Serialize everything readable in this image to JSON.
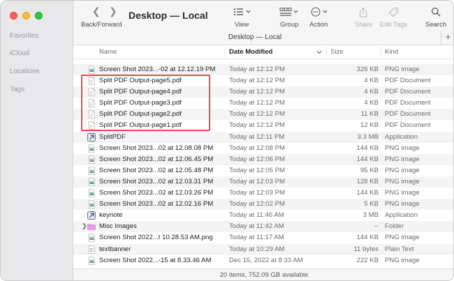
{
  "window": {
    "title": "Desktop — Local",
    "path_title": "Desktop — Local"
  },
  "sidebar": {
    "items": [
      {
        "label": "Favorites"
      },
      {
        "label": "iCloud"
      },
      {
        "label": "Locations"
      },
      {
        "label": "Tags"
      }
    ]
  },
  "toolbar": {
    "back_forward_label": "Back/Forward",
    "view_label": "View",
    "group_label": "Group",
    "action_label": "Action",
    "share_label": "Share",
    "edit_tags_label": "Edit Tags",
    "search_label": "Search"
  },
  "columns": {
    "name": "Name",
    "date": "Date Modified",
    "size": "Size",
    "kind": "Kind"
  },
  "files": [
    {
      "name": "Screen Shot 2023...-02 at 12.12.19 PM",
      "date": "Today at 12:12 PM",
      "size": "326 KB",
      "kind": "PNG image",
      "icon": "image-file-icon"
    },
    {
      "name": "Split PDF Output-page5.pdf",
      "date": "Today at 12:12 PM",
      "size": "4 KB",
      "kind": "PDF Document",
      "icon": "pdf-file-icon"
    },
    {
      "name": "Split PDF Output-page4.pdf",
      "date": "Today at 12:12 PM",
      "size": "4 KB",
      "kind": "PDF Document",
      "icon": "pdf-file-icon"
    },
    {
      "name": "Split PDF Output-page3.pdf",
      "date": "Today at 12:12 PM",
      "size": "4 KB",
      "kind": "PDF Document",
      "icon": "pdf-file-icon"
    },
    {
      "name": "Split PDF Output-page2.pdf",
      "date": "Today at 12:12 PM",
      "size": "11 KB",
      "kind": "PDF Document",
      "icon": "pdf-file-icon"
    },
    {
      "name": "Split PDF Output-page1.pdf",
      "date": "Today at 12:12 PM",
      "size": "12 KB",
      "kind": "PDF Document",
      "icon": "pdf-file-icon"
    },
    {
      "name": "SplitPDF",
      "date": "Today at 12:11 PM",
      "size": "3.3 MB",
      "kind": "Application",
      "icon": "app-icon"
    },
    {
      "name": "Screen Shot 2023...02 at 12.08.08 PM",
      "date": "Today at 12:08 PM",
      "size": "144 KB",
      "kind": "PNG image",
      "icon": "image-file-icon"
    },
    {
      "name": "Screen Shot 2023...02 at 12.06.45 PM",
      "date": "Today at 12:06 PM",
      "size": "144 KB",
      "kind": "PNG image",
      "icon": "image-file-icon"
    },
    {
      "name": "Screen Shot 2023...02 at 12.05.48 PM",
      "date": "Today at 12:05 PM",
      "size": "95 KB",
      "kind": "PNG image",
      "icon": "image-file-icon"
    },
    {
      "name": "Screen Shot 2023...02 at 12.03.31 PM",
      "date": "Today at 12:03 PM",
      "size": "128 KB",
      "kind": "PNG image",
      "icon": "image-file-icon"
    },
    {
      "name": "Screen Shot 2023...02 at 12.03.26 PM",
      "date": "Today at 12:03 PM",
      "size": "144 KB",
      "kind": "PNG image",
      "icon": "image-file-icon"
    },
    {
      "name": "Screen Shot 2023...02 at 12.02.16 PM",
      "date": "Today at 12:02 PM",
      "size": "5 KB",
      "kind": "PNG image",
      "icon": "image-file-icon"
    },
    {
      "name": "keynote",
      "date": "Today at 11:46 AM",
      "size": "3 MB",
      "kind": "Application",
      "icon": "app-icon"
    },
    {
      "name": "Misc Images",
      "date": "Today at 11:42 AM",
      "size": "--",
      "kind": "Folder",
      "icon": "folder-icon",
      "disclosure": "true"
    },
    {
      "name": "Screen Shot 2022...t 10.28.53 AM.png",
      "date": "Today at 11:17 AM",
      "size": "144 KB",
      "kind": "PNG image",
      "icon": "image-file-icon"
    },
    {
      "name": "textbanner",
      "date": "Today at 10:29 AM",
      "size": "11 bytes",
      "kind": "Plain Text",
      "icon": "text-file-icon"
    },
    {
      "name": "Screen Shot 2022...-15 at 8.33.46 AM",
      "date": "Dec 15, 2022 at 8:33 AM",
      "size": "222 KB",
      "kind": "PNG image",
      "icon": "image-file-icon"
    }
  ],
  "status": {
    "text": "20 items, 752.09 GB available"
  },
  "colors": {
    "highlight": "#e8474c",
    "sidebar_bg": "#e8e8ea",
    "folder": "#e59ce6"
  }
}
